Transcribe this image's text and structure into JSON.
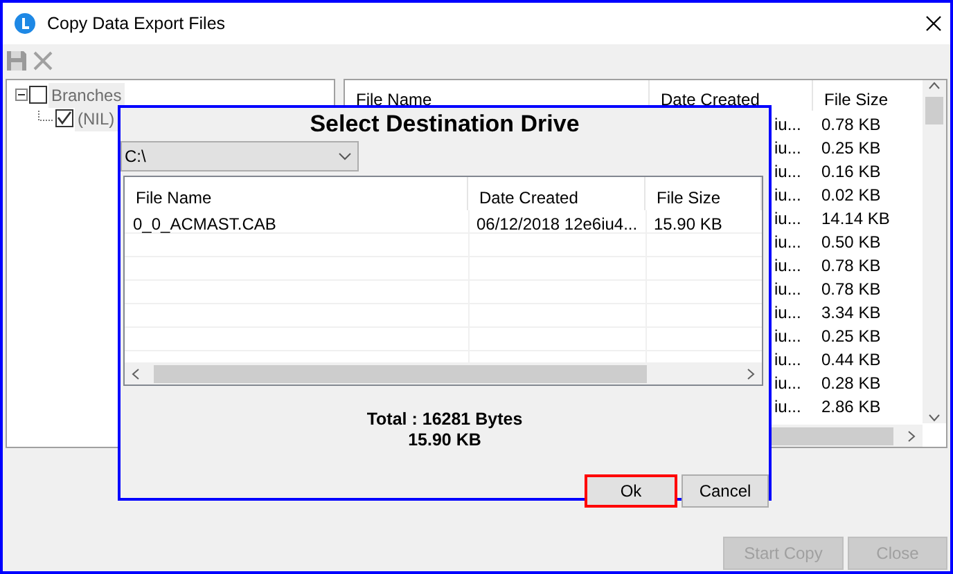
{
  "window": {
    "title": "Copy Data Export Files"
  },
  "tree": {
    "items": [
      {
        "label": "Branches",
        "checked": false,
        "expanded": true,
        "children": [
          {
            "label": "(NIL)",
            "checked": true
          }
        ]
      }
    ]
  },
  "file_list": {
    "columns": [
      "File Name",
      "Date Created",
      "File Size"
    ],
    "rows": [
      {
        "date_created": "iu...",
        "file_size": "0.78 KB"
      },
      {
        "date_created": "iu...",
        "file_size": "0.25 KB"
      },
      {
        "date_created": "iu...",
        "file_size": "0.16 KB"
      },
      {
        "date_created": "iu...",
        "file_size": "0.02 KB"
      },
      {
        "date_created": "iu...",
        "file_size": "14.14 KB"
      },
      {
        "date_created": "iu...",
        "file_size": "0.50 KB"
      },
      {
        "date_created": "iu...",
        "file_size": "0.78 KB"
      },
      {
        "date_created": "iu...",
        "file_size": "0.78 KB"
      },
      {
        "date_created": "iu...",
        "file_size": "3.34 KB"
      },
      {
        "date_created": "iu...",
        "file_size": "0.25 KB"
      },
      {
        "date_created": "iu...",
        "file_size": "0.44 KB"
      },
      {
        "date_created": "iu...",
        "file_size": "0.28 KB"
      },
      {
        "date_created": "iu...",
        "file_size": "2.86 KB"
      }
    ]
  },
  "dialog": {
    "title": "Select Destination Drive",
    "drive": "C:\\",
    "columns": [
      "File Name",
      "Date Created",
      "File Size"
    ],
    "rows": [
      {
        "file_name": "0_0_ACMAST.CAB",
        "date_created": "06/12/2018 12e6iu4...",
        "file_size": "15.90 KB"
      }
    ],
    "total_bytes": "Total : 16281 Bytes",
    "total_kb": "15.90 KB",
    "buttons": [
      {
        "label": "Ok",
        "focused": true
      },
      {
        "label": "Cancel",
        "focused": false
      }
    ]
  },
  "buttons": [
    {
      "label": "Start Copy",
      "disabled": true
    },
    {
      "label": "Close",
      "disabled": true
    }
  ]
}
